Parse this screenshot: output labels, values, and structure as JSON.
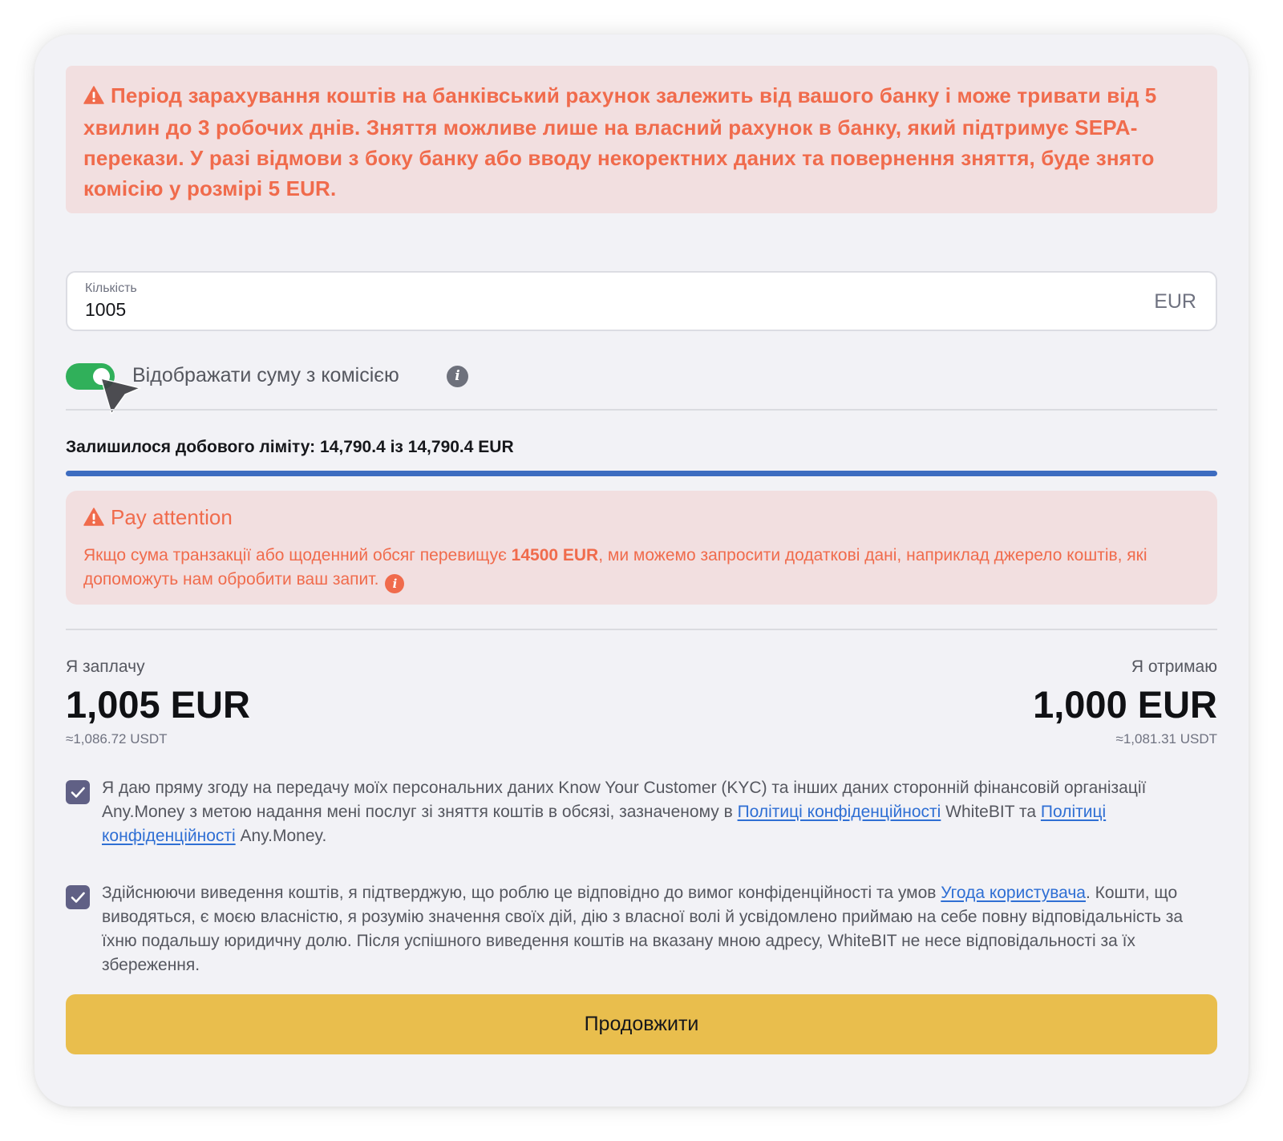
{
  "warning_banner": {
    "text": "Період зарахування коштів на банківський рахунок залежить від вашого банку і може тривати від 5 хвилин до 3 робочих днів. Зняття можливе лише на власний рахунок в банку, який підтримує SEPA-перекази. У разі відмови з боку банку або вводу некоректних даних та повернення зняття, буде знято комісію у розмірі 5 EUR.",
    "icon": "warning-triangle-icon"
  },
  "amount_field": {
    "label": "Кількість",
    "value": "1005",
    "currency": "EUR"
  },
  "fee_toggle": {
    "label": "Відображати суму з комісією",
    "enabled": true
  },
  "limit": {
    "text": "Залишилося добового ліміту: 14,790.4 із 14,790.4 EUR",
    "remaining_fraction": 1.0
  },
  "attention": {
    "title": "Pay attention",
    "body_prefix": "Якщо сума транзакції або щоденний обсяг перевищує ",
    "body_bold": "14500 EUR",
    "body_suffix": ", ми можемо запросити додаткові дані, наприклад джерело коштів, які допоможуть нам обробити ваш запит."
  },
  "summary": {
    "pay_label": "Я заплачу",
    "pay_amount": "1,005 EUR",
    "pay_approx": "≈1,086.72 USDT",
    "receive_label": "Я отримаю",
    "receive_amount": "1,000 EUR",
    "receive_approx": "≈1,081.31 USDT"
  },
  "consent_kyc": {
    "checked": true,
    "text_1": "Я даю пряму згоду на передачу моїх персональних даних Know Your Customer (KYC) та інших даних сторонній фінансовій організації Any.Money з метою надання мені послуг зі зняття коштів в обсязі, зазначеному в ",
    "link_1": "Політиці конфіденційності",
    "text_2": " WhiteBIT та ",
    "link_2": "Політиці конфіденційності",
    "text_3": " Any.Money."
  },
  "consent_withdraw": {
    "checked": true,
    "text_1": "Здійснюючи виведення коштів, я підтверджую, що роблю це відповідно до вимог конфіденційності та умов ",
    "link_1": "Угода користувача",
    "text_2": ". Кошти, що виводяться, є моєю власністю, я розумію значення своїх дій, дію з власної волі й усвідомлено приймаю на себе повну відповідальність за їхню подальшу юридичну долю. Після успішного виведення коштів на вказану мною адресу, WhiteBIT не несе відповідальності за їх збереження."
  },
  "continue_button": "Продовжити",
  "colors": {
    "warning_text": "#f06b4c",
    "warning_bg": "#f2dfe0",
    "toggle_on": "#30b05a",
    "limit_bar": "#3d6cc0",
    "checkbox": "#606085",
    "link": "#2f6fd4",
    "button": "#e9be4d"
  }
}
